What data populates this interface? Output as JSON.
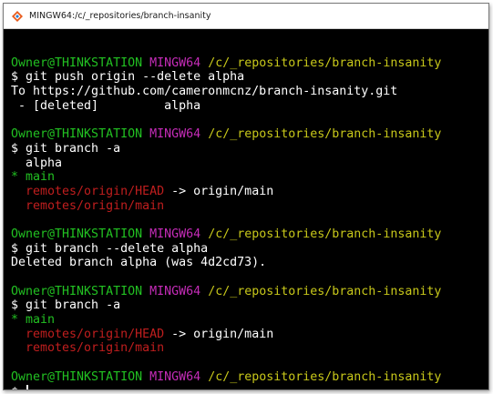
{
  "window": {
    "title": "MINGW64:/c/_repositories/branch-insanity"
  },
  "colors": {
    "prompt_user": "#22c122",
    "prompt_msystem": "#c52cb8",
    "prompt_path": "#c8c81a",
    "remote_branch": "#c01e1e",
    "current_branch": "#22c122",
    "background": "#000000",
    "text": "#ffffff"
  },
  "terminal": {
    "blocks": [
      {
        "prompt": {
          "user": "Owner@THINKSTATION",
          "msystem": "MINGW64",
          "path": "/c/_repositories/branch-insanity"
        },
        "command": "$ git push origin --delete alpha",
        "output": [
          "To https://github.com/cameronmcnz/branch-insanity.git",
          " - [deleted]         alpha"
        ]
      },
      {
        "prompt": {
          "user": "Owner@THINKSTATION",
          "msystem": "MINGW64",
          "path": "/c/_repositories/branch-insanity"
        },
        "command": "$ git branch -a",
        "output": [
          "  alpha",
          "* main",
          "  remotes/origin/HEAD",
          " -> origin/main",
          "  remotes/origin/main"
        ]
      },
      {
        "prompt": {
          "user": "Owner@THINKSTATION",
          "msystem": "MINGW64",
          "path": "/c/_repositories/branch-insanity"
        },
        "command": "$ git branch --delete alpha",
        "output": [
          "Deleted branch alpha (was 4d2cd73)."
        ]
      },
      {
        "prompt": {
          "user": "Owner@THINKSTATION",
          "msystem": "MINGW64",
          "path": "/c/_repositories/branch-insanity"
        },
        "command": "$ git branch -a",
        "output": [
          "* main",
          "  remotes/origin/HEAD",
          " -> origin/main",
          "  remotes/origin/main"
        ]
      },
      {
        "prompt": {
          "user": "Owner@THINKSTATION",
          "msystem": "MINGW64",
          "path": "/c/_repositories/branch-insanity"
        },
        "command": "$ "
      }
    ]
  }
}
